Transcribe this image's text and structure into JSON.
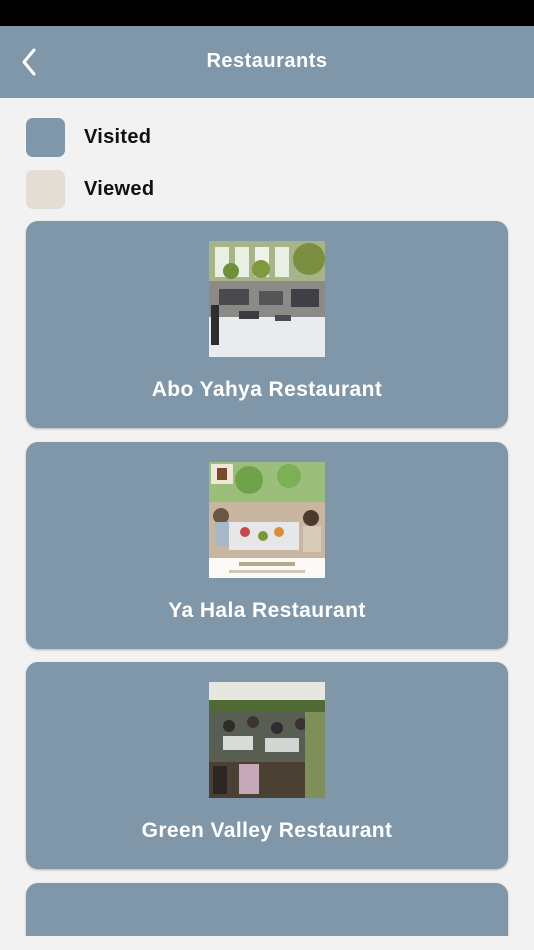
{
  "header": {
    "title": "Restaurants",
    "back_icon": "chevron-left-icon"
  },
  "legend": [
    {
      "label": "Visited",
      "color": "#7f97a8"
    },
    {
      "label": "Viewed",
      "color": "#e3ddd5"
    }
  ],
  "restaurants": [
    {
      "name": "Abo Yahya Restaurant",
      "photo": "dining-hall-photo"
    },
    {
      "name": "Ya Hala Restaurant",
      "photo": "group-dining-photo"
    },
    {
      "name": "Green Valley Restaurant",
      "photo": "garden-dining-photo"
    }
  ],
  "colors": {
    "primary": "#7f97a8",
    "background": "#f2f2f2",
    "viewed": "#e3ddd5"
  }
}
